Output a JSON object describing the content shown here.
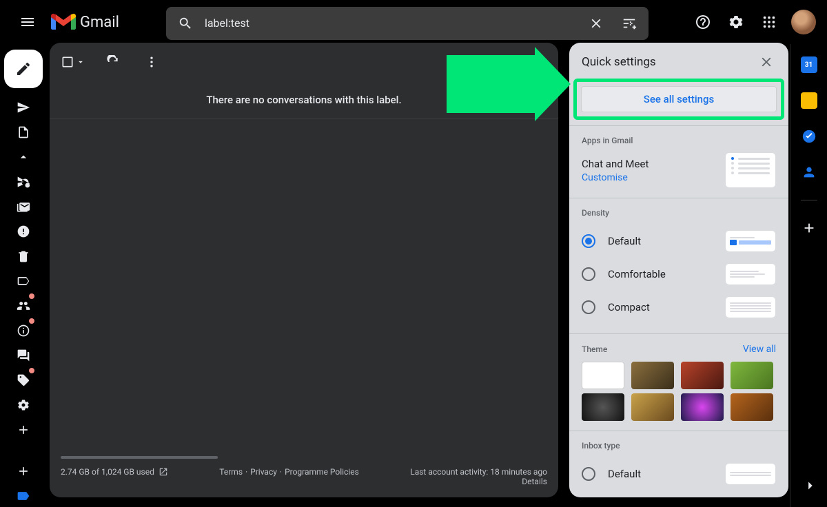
{
  "header": {
    "app_name": "Gmail",
    "search_value": "label:test"
  },
  "main": {
    "empty_message": "There are no conversations with this label.",
    "footer": {
      "storage_text": "2.74 GB of 1,024 GB used",
      "terms": "Terms",
      "privacy": "Privacy",
      "policies": "Programme Policies",
      "activity": "Last account activity: 18 minutes ago",
      "details": "Details"
    }
  },
  "quick_settings": {
    "title": "Quick settings",
    "see_all": "See all settings",
    "apps_label": "Apps in Gmail",
    "chat_meet": "Chat and Meet",
    "customise": "Customise",
    "density_label": "Density",
    "density_options": [
      {
        "label": "Default",
        "checked": true
      },
      {
        "label": "Comfortable",
        "checked": false
      },
      {
        "label": "Compact",
        "checked": false
      }
    ],
    "theme_label": "Theme",
    "view_all": "View all",
    "inbox_type_label": "Inbox type",
    "inbox_default": "Default"
  },
  "annotation": {
    "arrow_color": "#00e676"
  }
}
